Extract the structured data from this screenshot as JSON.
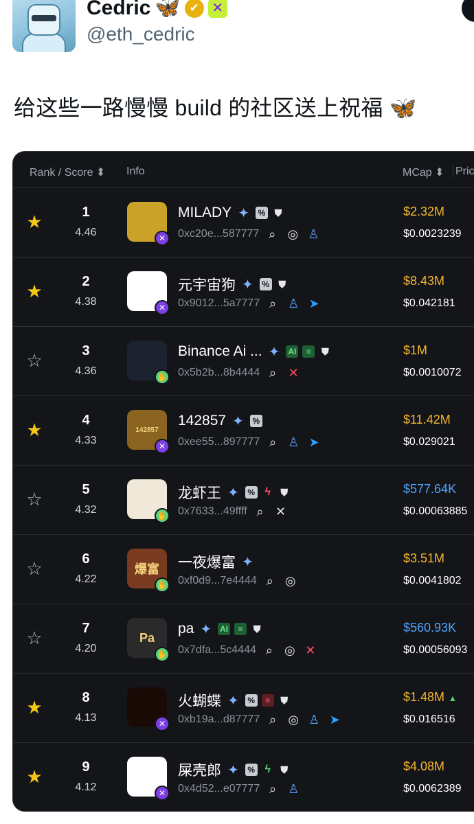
{
  "tweet": {
    "display_name": "Cedric",
    "name_emoji": "🦋",
    "verified_glyph": "✔",
    "affiliation_glyph": "✕",
    "handle": "@eth_cedric",
    "text": "给这些一路慢慢 build 的社区送上祝福 🦋"
  },
  "table": {
    "headers": {
      "rank_score": "Rank / Score ⬍",
      "info": "Info",
      "mcap": "MCap ⬍",
      "price": "Pric"
    },
    "rows": [
      {
        "starred": true,
        "rank": "1",
        "score": "4.46",
        "name": "MILADY",
        "logo_text": "",
        "logo_bg": "#c9a227",
        "chain": "x",
        "tags": [
          "spark",
          "pct",
          "shield"
        ],
        "addr": "0xc20e...587777",
        "links": [
          "search",
          "globe",
          "user"
        ],
        "mcap": "$2.32M",
        "mcap_color": "gold",
        "mcap_up": false,
        "price": "$0.0023239"
      },
      {
        "starred": true,
        "rank": "2",
        "score": "4.38",
        "name": "元宇宙狗",
        "logo_text": "",
        "logo_bg": "#ffffff",
        "chain": "x",
        "tags": [
          "spark",
          "pct",
          "shield"
        ],
        "addr": "0x9012...5a7777",
        "links": [
          "search",
          "user",
          "tg"
        ],
        "mcap": "$8.43M",
        "mcap_color": "gold",
        "mcap_up": false,
        "price": "$0.042181"
      },
      {
        "starred": false,
        "rank": "3",
        "score": "4.36",
        "name": "Binance Ai ...",
        "logo_text": "",
        "logo_bg": "#1c2230",
        "chain": "hand",
        "tags": [
          "spark",
          "ai",
          "list",
          "shield"
        ],
        "addr": "0x5b2b...8b4444",
        "links": [
          "search",
          "xred"
        ],
        "mcap": "$1M",
        "mcap_color": "gold",
        "mcap_up": false,
        "price": "$0.0010072"
      },
      {
        "starred": true,
        "rank": "4",
        "score": "4.33",
        "name": "142857",
        "logo_text": "142857",
        "logo_bg": "#8a6420",
        "chain": "x",
        "tags": [
          "spark",
          "pct"
        ],
        "addr": "0xee55...897777",
        "links": [
          "search",
          "user",
          "tg"
        ],
        "mcap": "$11.42M",
        "mcap_color": "gold",
        "mcap_up": false,
        "price": "$0.029021"
      },
      {
        "starred": false,
        "rank": "5",
        "score": "4.32",
        "name": "龙虾王",
        "logo_text": "",
        "logo_bg": "#f0e8d8",
        "chain": "hand",
        "tags": [
          "spark",
          "pct",
          "boltred",
          "shield"
        ],
        "addr": "0x7633...49ffff",
        "links": [
          "search",
          "xwhite"
        ],
        "mcap": "$577.64K",
        "mcap_color": "blue",
        "mcap_up": false,
        "price": "$0.00063885"
      },
      {
        "starred": false,
        "rank": "6",
        "score": "4.22",
        "name": "一夜爆富",
        "logo_text": "爆富",
        "logo_bg": "#7a3a1f",
        "chain": "hand",
        "tags": [
          "spark"
        ],
        "addr": "0xf0d9...7e4444",
        "links": [
          "search",
          "globe"
        ],
        "mcap": "$3.51M",
        "mcap_color": "gold",
        "mcap_up": false,
        "price": "$0.0041802"
      },
      {
        "starred": false,
        "rank": "7",
        "score": "4.20",
        "name": "pa",
        "logo_text": "Pa",
        "logo_bg": "#2a2a2a",
        "chain": "hand",
        "tags": [
          "spark",
          "ai",
          "list",
          "shield"
        ],
        "addr": "0x7dfa...5c4444",
        "links": [
          "search",
          "globe",
          "xred"
        ],
        "mcap": "$560.93K",
        "mcap_color": "blue",
        "mcap_up": false,
        "price": "$0.00056093"
      },
      {
        "starred": true,
        "rank": "8",
        "score": "4.13",
        "name": "火蝴蝶",
        "logo_text": "",
        "logo_bg": "#1a0a06",
        "chain": "x",
        "tags": [
          "spark",
          "pct",
          "listred",
          "shield"
        ],
        "addr": "0xb19a...d87777",
        "links": [
          "search",
          "globe",
          "user",
          "tg"
        ],
        "mcap": "$1.48M",
        "mcap_color": "gold",
        "mcap_up": true,
        "price": "$0.016516"
      },
      {
        "starred": true,
        "rank": "9",
        "score": "4.12",
        "name": "屎壳郎",
        "logo_text": "",
        "logo_bg": "#ffffff",
        "chain": "x",
        "tags": [
          "spark",
          "pct",
          "boltgreen",
          "shield"
        ],
        "addr": "0x4d52...e07777",
        "links": [
          "search",
          "user"
        ],
        "mcap": "$4.08M",
        "mcap_color": "gold",
        "mcap_up": false,
        "price": "$0.0062389"
      }
    ]
  },
  "tag_labels": {
    "spark": "✦",
    "pct": "%",
    "ai": "AI",
    "list": "≡",
    "listred": "≡",
    "shield": "⛊",
    "boltred": "ϟ",
    "boltgreen": "ϟ"
  },
  "link_glyphs": {
    "search": "⌕",
    "globe": "◎",
    "user": "♙",
    "tg": "➤",
    "xred": "✕",
    "xwhite": "✕"
  },
  "chain_glyphs": {
    "x": "✕",
    "hand": "✋"
  },
  "star_glyphs": {
    "on": "★",
    "off": "☆"
  },
  "up_glyph": "▲",
  "colors": {
    "gold": "#f5b82e",
    "blue": "#4ea4ff",
    "panel_bg": "#141519",
    "star": "#f5c518"
  }
}
